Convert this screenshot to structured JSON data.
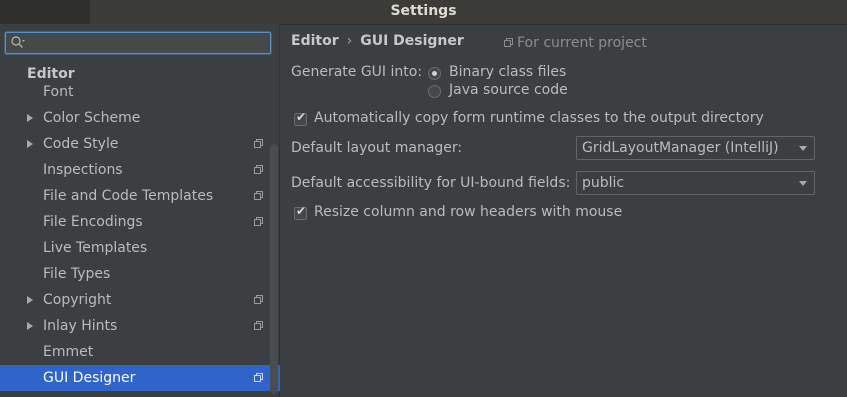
{
  "window": {
    "title": "Settings"
  },
  "sidebar": {
    "search": {
      "value": "",
      "placeholder": ""
    },
    "section_header": "Editor",
    "items": [
      {
        "label": "Font",
        "expandable": false,
        "project_icon": false
      },
      {
        "label": "Color Scheme",
        "expandable": true,
        "project_icon": false
      },
      {
        "label": "Code Style",
        "expandable": true,
        "project_icon": true
      },
      {
        "label": "Inspections",
        "expandable": false,
        "project_icon": true
      },
      {
        "label": "File and Code Templates",
        "expandable": false,
        "project_icon": true
      },
      {
        "label": "File Encodings",
        "expandable": false,
        "project_icon": true
      },
      {
        "label": "Live Templates",
        "expandable": false,
        "project_icon": false
      },
      {
        "label": "File Types",
        "expandable": false,
        "project_icon": false
      },
      {
        "label": "Copyright",
        "expandable": true,
        "project_icon": true
      },
      {
        "label": "Inlay Hints",
        "expandable": true,
        "project_icon": true
      },
      {
        "label": "Emmet",
        "expandable": false,
        "project_icon": false
      },
      {
        "label": "GUI Designer",
        "expandable": false,
        "project_icon": true,
        "selected": true
      }
    ]
  },
  "main": {
    "breadcrumb": {
      "parent": "Editor",
      "separator": "›",
      "current": "GUI Designer"
    },
    "project_note": "For current project",
    "generate_gui": {
      "label": "Generate GUI into:",
      "options": [
        {
          "label": "Binary class files",
          "checked": true
        },
        {
          "label": "Java source code",
          "checked": false
        }
      ]
    },
    "copy_runtime": {
      "label": "Automatically copy form runtime classes to the output directory",
      "checked": true
    },
    "layout_manager": {
      "label": "Default layout manager:",
      "value": "GridLayoutManager (IntelliJ)"
    },
    "accessibility": {
      "label": "Default accessibility for UI-bound fields:",
      "value": "public"
    },
    "resize_headers": {
      "label": "Resize column and row headers with mouse",
      "checked": true
    }
  },
  "colors": {
    "background": "#3c3f41",
    "selection": "#2f65ca",
    "focus": "#5b8ec7",
    "text": "#bbbbbb"
  }
}
